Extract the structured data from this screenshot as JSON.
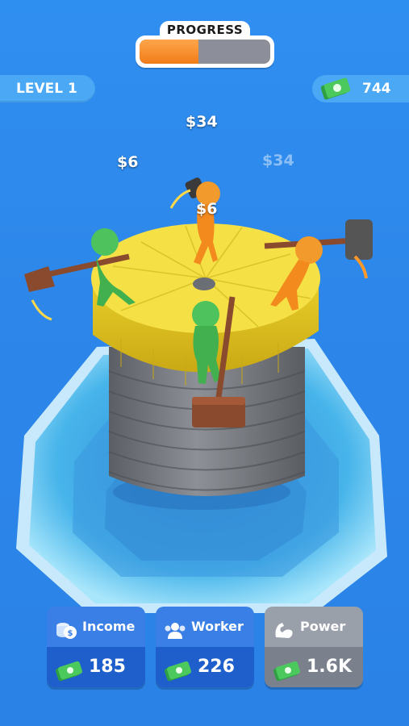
{
  "hud": {
    "progress_label": "PROGRESS",
    "progress_fraction": 0.45,
    "level_label": "LEVEL 1",
    "money_value": "744"
  },
  "floating_rewards": [
    "$34",
    "$6",
    "$34",
    "$6"
  ],
  "buttons": {
    "income": {
      "label": "Income",
      "value": "185"
    },
    "worker": {
      "label": "Worker",
      "value": "226"
    },
    "power": {
      "label": "Power",
      "value": "1.6K"
    }
  },
  "colors": {
    "sky": "#2d87ea",
    "ice": "#5fc8ec",
    "tower_top": "#f2df3a",
    "tower_body": "#777a80",
    "worker_green": "#4ec25c",
    "worker_orange": "#f29a2b",
    "button_blue": "#1f5fcc",
    "button_gray": "#7b818c"
  }
}
